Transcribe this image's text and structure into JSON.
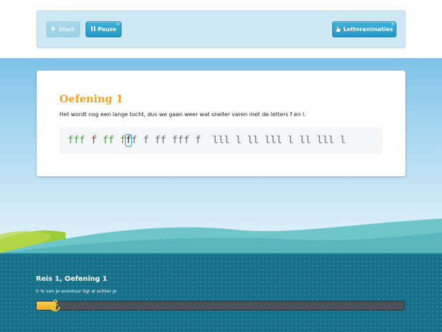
{
  "toolbar": {
    "start_label": "Start",
    "pause_label": "Pauze",
    "letters_label": "Letteranimaties",
    "corner_mark": "≡"
  },
  "exercise": {
    "title": "Oefening 1",
    "description": "Het wordt nog een lange tocht, dus we gaan weer wat sneller varen met de letters f en l.",
    "letters": [
      {
        "char": "f",
        "state": "done"
      },
      {
        "char": "f",
        "state": "done"
      },
      {
        "char": "f",
        "state": "done"
      },
      {
        "char": " ",
        "state": "space"
      },
      {
        "char": "f",
        "state": "wrong"
      },
      {
        "char": " ",
        "state": "space"
      },
      {
        "char": "f",
        "state": "done"
      },
      {
        "char": "f",
        "state": "done"
      },
      {
        "char": " ",
        "state": "space"
      },
      {
        "char": "f",
        "state": "done"
      },
      {
        "char": "f",
        "state": "current"
      },
      {
        "char": "f",
        "state": "todo"
      },
      {
        "char": " ",
        "state": "space"
      },
      {
        "char": "f",
        "state": "todo"
      },
      {
        "char": " ",
        "state": "space"
      },
      {
        "char": "f",
        "state": "todo"
      },
      {
        "char": "f",
        "state": "todo"
      },
      {
        "char": " ",
        "state": "space"
      },
      {
        "char": "f",
        "state": "todo"
      },
      {
        "char": "f",
        "state": "todo"
      },
      {
        "char": "f",
        "state": "todo"
      },
      {
        "char": " ",
        "state": "space"
      },
      {
        "char": "f",
        "state": "todo"
      },
      {
        "char": " ",
        "state": "space"
      },
      {
        "char": " ",
        "state": "space"
      },
      {
        "char": "l",
        "state": "todo"
      },
      {
        "char": "l",
        "state": "todo"
      },
      {
        "char": "l",
        "state": "todo"
      },
      {
        "char": " ",
        "state": "space"
      },
      {
        "char": "l",
        "state": "todo"
      },
      {
        "char": " ",
        "state": "space"
      },
      {
        "char": "l",
        "state": "todo"
      },
      {
        "char": "l",
        "state": "todo"
      },
      {
        "char": " ",
        "state": "space"
      },
      {
        "char": "l",
        "state": "todo"
      },
      {
        "char": "l",
        "state": "todo"
      },
      {
        "char": "l",
        "state": "todo"
      },
      {
        "char": " ",
        "state": "space"
      },
      {
        "char": "l",
        "state": "todo"
      },
      {
        "char": " ",
        "state": "space"
      },
      {
        "char": "l",
        "state": "todo"
      },
      {
        "char": "l",
        "state": "todo"
      },
      {
        "char": " ",
        "state": "space"
      },
      {
        "char": "l",
        "state": "todo"
      },
      {
        "char": "l",
        "state": "todo"
      },
      {
        "char": "l",
        "state": "todo"
      },
      {
        "char": " ",
        "state": "space"
      },
      {
        "char": "l",
        "state": "todo"
      }
    ]
  },
  "journey": {
    "title": "Reis 1, Oefening 1",
    "progress_text": "5 % van je avontuur ligt al achter je",
    "progress_percent": 5
  },
  "colors": {
    "accent": "#f2a227",
    "done": "#43a642",
    "wrong": "#c7262a",
    "todo": "#6b6e72",
    "button": "#2497c4",
    "bottom_panel": "#176f88"
  },
  "icons": {
    "start": "play-icon",
    "pause": "pause-icon",
    "letters": "hand-pointer-icon",
    "progress_marker": "anchor-icon"
  }
}
